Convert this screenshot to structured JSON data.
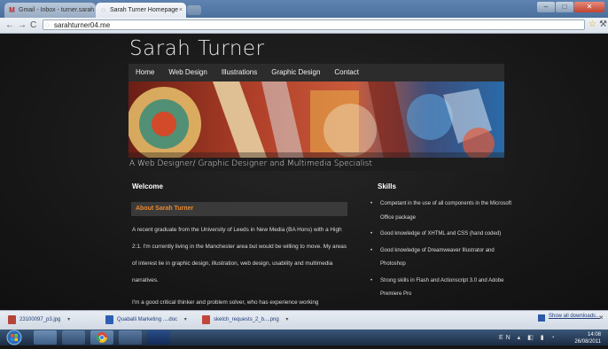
{
  "browser": {
    "tabs": [
      {
        "title": "Gmail - Inbox - turner.sarah",
        "favicon": "gmail-icon",
        "active": false
      },
      {
        "title": "Sarah Turner Homepage",
        "favicon": "page-icon",
        "active": true
      }
    ],
    "url": "sarahturner04.me"
  },
  "site": {
    "title": "Sarah Turner",
    "nav": [
      "Home",
      "Web Design",
      "Illustrations",
      "Graphic Design",
      "Contact"
    ],
    "tagline": "A Web Designer/ Graphic Designer and Multimedia Specialist",
    "accent_color": "#e8882a"
  },
  "welcome": {
    "heading": "Welcome",
    "about_heading": "About Sarah Turner",
    "bio": "A recent graduate from the University of Leeds in New Media (BA Hons) with a High 2:1. I'm currently living in the Manchester area but would be willing to move. My areas of interest lie in graphic design, illustration, web design, usability and multimedia narratives.",
    "bio_cont": "I'm a good critical thinker and problem solver, who has experience working"
  },
  "skills": {
    "heading": "Skills",
    "items": [
      "Competant in the use of all components in the Microsoft Office package",
      "Good knowledge of XHTML and CSS (hand coded)",
      "Good knowledge of Dreamweaver Illustrator and Photoshop",
      "Strong skills in Flash and Actionscript 3.0 and Adobe Premiere Pro"
    ]
  },
  "downloads": {
    "items": [
      "23100097_p3.jpg",
      "Quaballi Marketing ....doc",
      "sketch_requests_2_b....png"
    ],
    "show_all": "Show all downloads..."
  },
  "taskbar": {
    "lang": "EN",
    "time": "14:08",
    "date": "26/08/2011"
  }
}
